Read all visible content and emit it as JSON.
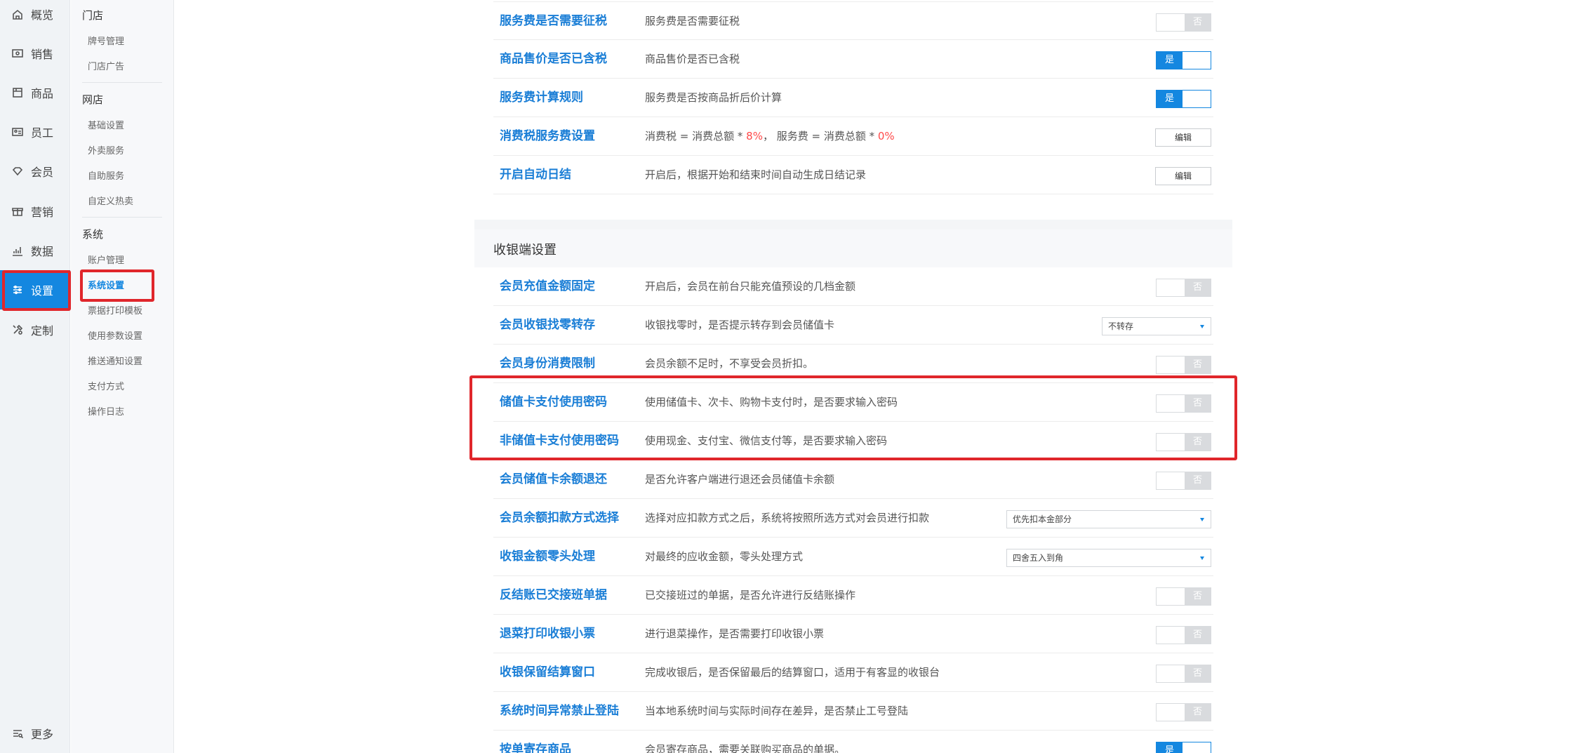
{
  "rail": {
    "items": [
      {
        "label": "概览",
        "icon": "home-icon"
      },
      {
        "label": "销售",
        "icon": "sales-icon"
      },
      {
        "label": "商品",
        "icon": "goods-icon"
      },
      {
        "label": "员工",
        "icon": "staff-icon"
      },
      {
        "label": "会员",
        "icon": "member-icon"
      },
      {
        "label": "营销",
        "icon": "marketing-icon"
      },
      {
        "label": "数据",
        "icon": "chart-icon"
      },
      {
        "label": "设置",
        "icon": "settings-icon",
        "active": true
      },
      {
        "label": "定制",
        "icon": "tools-icon"
      }
    ],
    "more": "更多"
  },
  "subnav": {
    "groups": [
      {
        "title": "门店",
        "items": [
          "牌号管理",
          "门店广告"
        ]
      },
      {
        "title": "网店",
        "items": [
          "基础设置",
          "外卖服务",
          "自助服务",
          "自定义热卖"
        ]
      },
      {
        "title": "系统",
        "items": [
          "账户管理",
          "系统设置",
          "票据打印模板",
          "使用参数设置",
          "推送通知设置",
          "支付方式",
          "操作日志"
        ]
      }
    ],
    "active": "系统设置"
  },
  "top_rows": [
    {
      "label": "服务费是否需要征税",
      "desc": "服务费是否需要征税",
      "control": "toggle",
      "value": "否"
    },
    {
      "label": "商品售价是否已含税",
      "desc": "商品售价是否已含税",
      "control": "toggle",
      "value": "是"
    },
    {
      "label": "服务费计算规则",
      "desc": "服务费是否按商品折后价计算",
      "control": "toggle",
      "value": "是"
    },
    {
      "label": "消费税服务费设置",
      "desc_parts": [
        "消费税 = 消费总额 * ",
        "8%",
        "， 服务费 = 消费总额 * ",
        "0%"
      ],
      "control": "button",
      "value": "编辑"
    },
    {
      "label": "开启自动日结",
      "desc": "开启后，根据开始和结束时间自动生成日结记录",
      "control": "button",
      "value": "编辑"
    }
  ],
  "cashier_section": {
    "title": "收银端设置",
    "rows": [
      {
        "label": "会员充值金额固定",
        "desc": "开启后，会员在前台只能充值预设的几档金额",
        "control": "toggle",
        "value": "否"
      },
      {
        "label": "会员收银找零转存",
        "desc": "收银找零时，是否提示转存到会员储值卡",
        "control": "select",
        "value": "不转存"
      },
      {
        "label": "会员身份消费限制",
        "desc": "会员余额不足时，不享受会员折扣。",
        "control": "toggle",
        "value": "否"
      },
      {
        "label": "储值卡支付使用密码",
        "desc": "使用储值卡、次卡、购物卡支付时，是否要求输入密码",
        "control": "toggle",
        "value": "否"
      },
      {
        "label": "非储值卡支付使用密码",
        "desc": "使用现金、支付宝、微信支付等，是否要求输入密码",
        "control": "toggle",
        "value": "否"
      },
      {
        "label": "会员储值卡余额退还",
        "desc": "是否允许客户端进行退还会员储值卡余额",
        "control": "toggle",
        "value": "否"
      },
      {
        "label": "会员余额扣款方式选择",
        "desc": "选择对应扣款方式之后，系统将按照所选方式对会员进行扣款",
        "control": "select",
        "value": "优先扣本金部分"
      },
      {
        "label": "收银金额零头处理",
        "desc": "对最终的应收金额，零头处理方式",
        "control": "select",
        "value": "四舍五入到角"
      },
      {
        "label": "反结账已交接班单据",
        "desc": "已交接班过的单据，是否允许进行反结账操作",
        "control": "toggle",
        "value": "否"
      },
      {
        "label": "退菜打印收银小票",
        "desc": "进行退菜操作，是否需要打印收银小票",
        "control": "toggle",
        "value": "否"
      },
      {
        "label": "收银保留结算窗口",
        "desc": "完成收银后，是否保留最后的结算窗口，适用于有客显的收银台",
        "control": "toggle",
        "value": "否"
      },
      {
        "label": "系统时间异常禁止登陆",
        "desc": "当本地系统时间与实际时间存在差异，是否禁止工号登陆",
        "control": "toggle",
        "value": "否"
      },
      {
        "label": "按单寄存商品",
        "desc": "会员寄存商品，需要关联购买商品的单据。",
        "control": "toggle",
        "value": "是"
      }
    ]
  },
  "colors": {
    "accent": "#1487e0",
    "highlight": "#e0262b",
    "link": "#1a7ed6"
  }
}
